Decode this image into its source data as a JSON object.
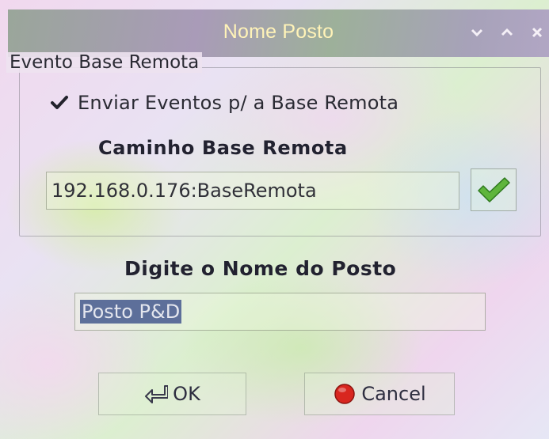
{
  "window": {
    "title": "Nome Posto",
    "minimize_icon": "chevron-down-icon",
    "maximize_icon": "chevron-up-icon",
    "close_icon": "close-icon",
    "title_color": "#fff3b8"
  },
  "group": {
    "legend": "Evento Base Remota",
    "checkbox_label": "Enviar Eventos p/ a Base Remota",
    "checkbox_checked": true,
    "path_label": "Caminho Base Remota",
    "path_value": "192.168.0.176:BaseRemota",
    "confirm_icon": "green-checkmark-icon"
  },
  "nome": {
    "label": "Digite o Nome do Posto",
    "value": "Posto P&D",
    "selected": true,
    "selection_color": "#5d6f9a"
  },
  "buttons": {
    "ok_label": "OK",
    "ok_icon": "return-arrow-icon",
    "cancel_label": "Cancel",
    "cancel_icon": "red-stop-icon"
  },
  "colors": {
    "check_green": "#5fb53c",
    "cancel_red": "#d8261f"
  }
}
